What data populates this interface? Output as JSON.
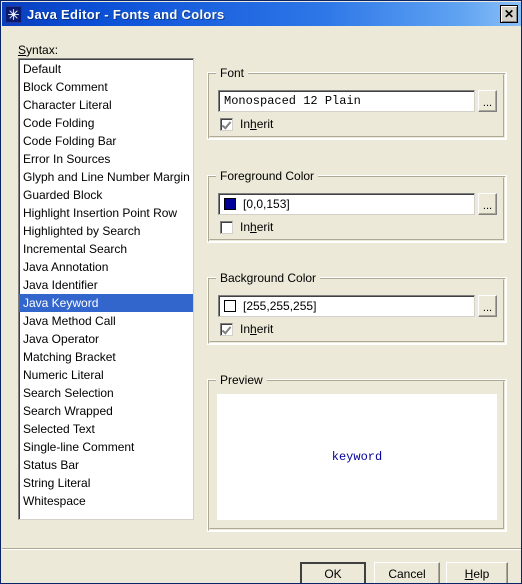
{
  "window": {
    "title": "Java Editor - Fonts and Colors",
    "icon": "java-coffee-icon",
    "close_label": "✕"
  },
  "syntax": {
    "label_prefix": "S",
    "label_rest": "yntax:",
    "selected": "Java Keyword",
    "items": [
      "Default",
      "Block Comment",
      "Character Literal",
      "Code Folding",
      "Code Folding Bar",
      "Error In Sources",
      "Glyph and Line Number Margin",
      "Guarded Block",
      "Highlight Insertion Point Row",
      "Highlighted by Search",
      "Incremental Search",
      "Java Annotation",
      "Java Identifier",
      "Java Keyword",
      "Java Method Call",
      "Java Operator",
      "Matching Bracket",
      "Numeric Literal",
      "Search Selection",
      "Search Wrapped",
      "Selected Text",
      "Single-line Comment",
      "Status Bar",
      "String Literal",
      "Whitespace"
    ]
  },
  "font_group": {
    "title": "Font",
    "value": "Monospaced 12 Plain",
    "browse_label": "...",
    "inherit": {
      "pre": "In",
      "acc": "h",
      "post": "erit",
      "checked": true
    }
  },
  "foreground_group": {
    "title": "Foreground Color",
    "value": "[0,0,153]",
    "swatch_color": "#000099",
    "browse_label": "...",
    "inherit": {
      "pre": "In",
      "acc": "h",
      "post": "erit",
      "checked": false
    }
  },
  "background_group": {
    "title": "Background Color",
    "value": "[255,255,255]",
    "swatch_color": "#FFFFFF",
    "browse_label": "...",
    "inherit": {
      "pre": "In",
      "acc": "h",
      "post": "erit",
      "checked": true
    }
  },
  "preview_group": {
    "title": "Preview",
    "sample_text": "keyword",
    "sample_color": "#000099",
    "sample_background": "#FFFFFF"
  },
  "buttons": {
    "ok": "OK",
    "cancel": "Cancel",
    "help_pre": "",
    "help_acc": "H",
    "help_post": "elp"
  },
  "colors": {
    "dialog_background": "#ECE9D8",
    "titlebar_start": "#0A3FBE",
    "titlebar_end": "#8CC0F8",
    "selection_blue": "#3366CC"
  }
}
